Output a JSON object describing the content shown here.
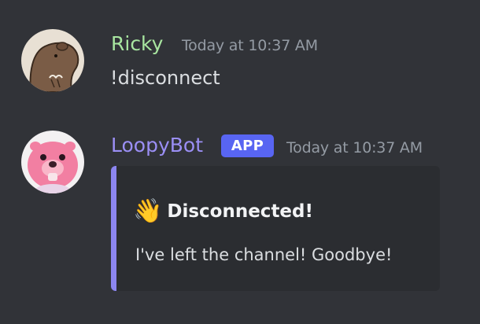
{
  "messages": [
    {
      "author": "Ricky",
      "author_color": "#a8e6a0",
      "avatar": "capybara-avatar-icon",
      "timestamp": "Today at 10:37 AM",
      "content": "!disconnect"
    },
    {
      "author": "LoopyBot",
      "author_color": "#9b8ff5",
      "avatar": "loopy-avatar-icon",
      "badge": "APP",
      "timestamp": "Today at 10:37 AM",
      "embed": {
        "accent_color": "#8c86f0",
        "emoji": "👋",
        "title": "Disconnected!",
        "description": "I've left the channel! Goodbye!"
      }
    }
  ]
}
